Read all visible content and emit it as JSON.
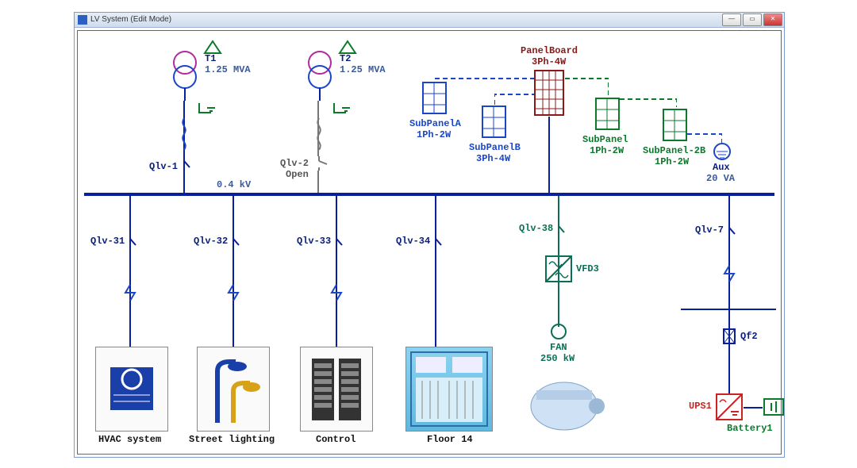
{
  "window": {
    "title": "LV System (Edit Mode)",
    "min_label": "—",
    "max_label": "▭",
    "close_label": "✕"
  },
  "bus_voltage": "0.4 kV",
  "transformers": [
    {
      "name": "T1",
      "rating": "1.25 MVA",
      "breaker": "Qlv-1"
    },
    {
      "name": "T2",
      "rating": "1.25 MVA",
      "breaker": "Qlv-2",
      "state": "Open"
    }
  ],
  "panelboard": {
    "name": "PanelBoard",
    "conf": "3Ph-4W"
  },
  "subpanels": [
    {
      "name": "SubPanelA",
      "conf": "1Ph-2W",
      "color": "blue"
    },
    {
      "name": "SubPanelB",
      "conf": "3Ph-4W",
      "color": "blue"
    },
    {
      "name": "SubPanel",
      "conf": "1Ph-2W",
      "color": "green"
    },
    {
      "name": "SubPanel-2B",
      "conf": "1Ph-2W",
      "color": "green"
    }
  ],
  "aux": {
    "name": "Aux",
    "rating": "20 VA"
  },
  "feeders": [
    {
      "breaker": "Qlv-31",
      "load": "HVAC system"
    },
    {
      "breaker": "Qlv-32",
      "load": "Street lighting"
    },
    {
      "breaker": "Qlv-33",
      "load": "Control"
    },
    {
      "breaker": "Qlv-34",
      "load": "Floor 14"
    }
  ],
  "vfd": {
    "breaker": "Qlv-38",
    "name": "VFD3",
    "fan_name": "FAN",
    "fan_rating": "250 kW"
  },
  "ups_line": {
    "breaker": "Qlv-7",
    "cb": "Qf2",
    "ups": "UPS1",
    "battery": "Battery1"
  }
}
